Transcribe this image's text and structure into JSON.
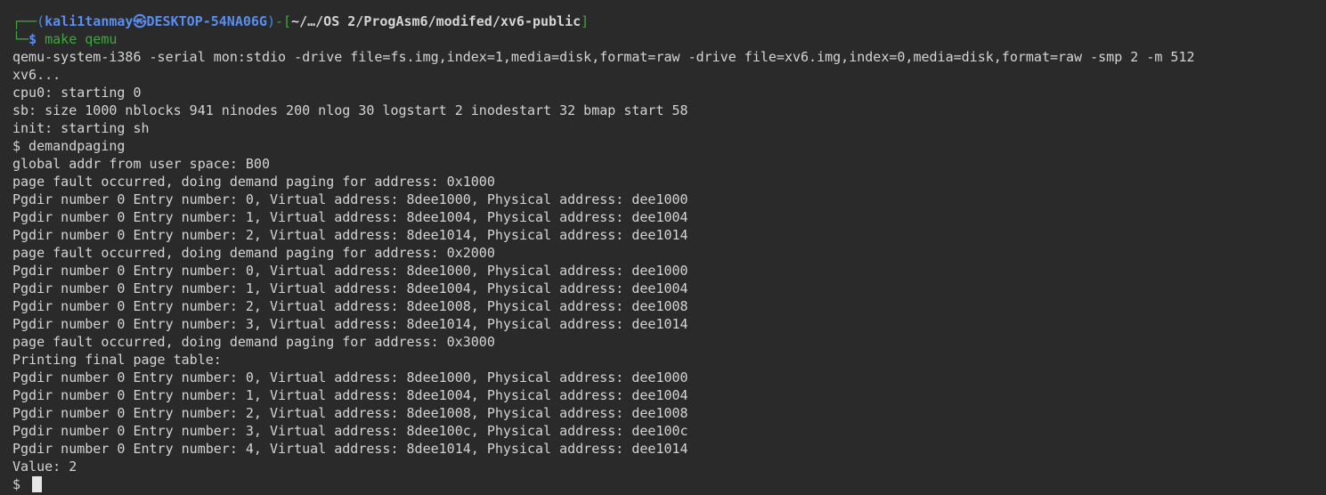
{
  "prompt": {
    "tree_top": "┌──",
    "open_paren": "(",
    "user": "kali1tanmay",
    "at_symbol": "㉿",
    "host": "DESKTOP-54NA06G",
    "close_paren": ")",
    "separator": "-",
    "open_bracket": "[",
    "path": "~/…/OS 2/ProgAsm6/modifed/xv6-public",
    "close_bracket": "]",
    "tree_bottom": "└─",
    "dollar": "$",
    "command": "make qemu"
  },
  "output_lines": [
    "qemu-system-i386 -serial mon:stdio -drive file=fs.img,index=1,media=disk,format=raw -drive file=xv6.img,index=0,media=disk,format=raw -smp 2 -m 512",
    "xv6...",
    "cpu0: starting 0",
    "sb: size 1000 nblocks 941 ninodes 200 nlog 30 logstart 2 inodestart 32 bmap start 58",
    "init: starting sh",
    "$ demandpaging",
    "global addr from user space: B00",
    "page fault occurred, doing demand paging for address: 0x1000",
    "Pgdir number 0 Entry number: 0, Virtual address: 8dee1000, Physical address: dee1000",
    "Pgdir number 0 Entry number: 1, Virtual address: 8dee1004, Physical address: dee1004",
    "Pgdir number 0 Entry number: 2, Virtual address: 8dee1014, Physical address: dee1014",
    "page fault occurred, doing demand paging for address: 0x2000",
    "Pgdir number 0 Entry number: 0, Virtual address: 8dee1000, Physical address: dee1000",
    "Pgdir number 0 Entry number: 1, Virtual address: 8dee1004, Physical address: dee1004",
    "Pgdir number 0 Entry number: 2, Virtual address: 8dee1008, Physical address: dee1008",
    "Pgdir number 0 Entry number: 3, Virtual address: 8dee1014, Physical address: dee1014",
    "page fault occurred, doing demand paging for address: 0x3000",
    "Printing final page table:",
    "Pgdir number 0 Entry number: 0, Virtual address: 8dee1000, Physical address: dee1000",
    "Pgdir number 0 Entry number: 1, Virtual address: 8dee1004, Physical address: dee1004",
    "Pgdir number 0 Entry number: 2, Virtual address: 8dee1008, Physical address: dee1008",
    "Pgdir number 0 Entry number: 3, Virtual address: 8dee100c, Physical address: dee100c",
    "Pgdir number 0 Entry number: 4, Virtual address: 8dee1014, Physical address: dee1014",
    "Value: 2"
  ],
  "final_prompt": "$",
  "colors": {
    "background": "#2a2a2a",
    "text": "#d4d4d4",
    "prompt_blue": "#5a8df0",
    "prompt_green": "#3ea83e"
  }
}
